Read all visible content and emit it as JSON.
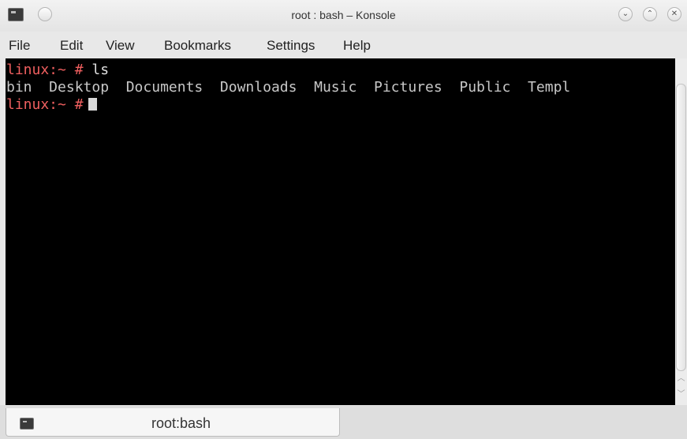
{
  "window": {
    "title": "root : bash – Konsole",
    "app_icon": "terminal-icon",
    "controls": [
      {
        "name": "minimize",
        "glyph": "⌄"
      },
      {
        "name": "maximize",
        "glyph": "⌃"
      },
      {
        "name": "close",
        "glyph": "✕"
      }
    ]
  },
  "menu": {
    "items": [
      "File",
      "Edit",
      "View",
      "Bookmarks",
      "Settings",
      "Help"
    ]
  },
  "terminal": {
    "line1": {
      "prompt": "linux:~ #",
      "command": "ls"
    },
    "line2": {
      "output": "bin  Desktop  Documents  Downloads  Music  Pictures  Public  Templ"
    },
    "line3": {
      "prompt": "linux:~ #"
    },
    "colors": {
      "background": "#000000",
      "prompt": "#ef5f5f",
      "text": "#c8c8c8"
    }
  },
  "tabs": [
    {
      "label": "root:bash",
      "icon": "terminal-icon",
      "active": true
    }
  ]
}
